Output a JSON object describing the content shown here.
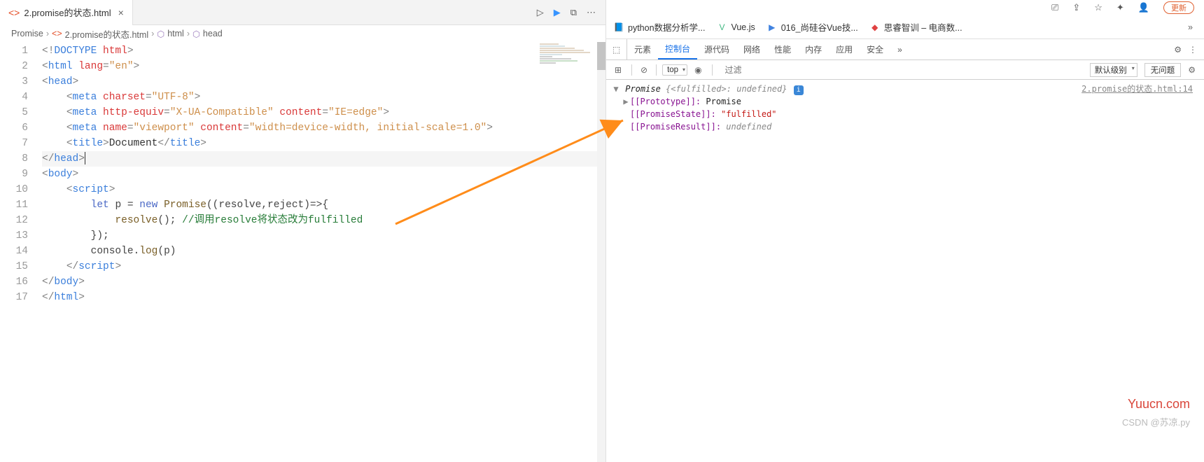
{
  "editor": {
    "tab": {
      "filename": "2.promise的状态.html"
    },
    "breadcrumb": [
      "Promise",
      "2.promise的状态.html",
      "html",
      "head"
    ],
    "lines": [
      {
        "n": 1,
        "html": "<span class='t-gray'>&lt;!</span><span class='t-blue'>DOCTYPE</span> <span class='t-red'>html</span><span class='t-gray'>&gt;</span>"
      },
      {
        "n": 2,
        "html": "<span class='t-gray'>&lt;</span><span class='t-blue'>html</span> <span class='t-red'>lang</span><span class='t-gray'>=</span><span class='t-str'>\"en\"</span><span class='t-gray'>&gt;</span>"
      },
      {
        "n": 3,
        "html": "<span class='t-gray'>&lt;</span><span class='t-blue'>head</span><span class='t-gray'>&gt;</span>"
      },
      {
        "n": 4,
        "html": "    <span class='t-gray'>&lt;</span><span class='t-blue'>meta</span> <span class='t-red'>charset</span><span class='t-gray'>=</span><span class='t-str'>\"UTF-8\"</span><span class='t-gray'>&gt;</span>"
      },
      {
        "n": 5,
        "html": "    <span class='t-gray'>&lt;</span><span class='t-blue'>meta</span> <span class='t-red'>http-equiv</span><span class='t-gray'>=</span><span class='t-str'>\"X-UA-Compatible\"</span> <span class='t-red'>content</span><span class='t-gray'>=</span><span class='t-str'>\"IE=edge\"</span><span class='t-gray'>&gt;</span>"
      },
      {
        "n": 6,
        "html": "    <span class='t-gray'>&lt;</span><span class='t-blue'>meta</span> <span class='t-red'>name</span><span class='t-gray'>=</span><span class='t-str'>\"viewport\"</span> <span class='t-red'>content</span><span class='t-gray'>=</span><span class='t-str'>\"width=device-width, initial-scale=1.0\"</span><span class='t-gray'>&gt;</span>"
      },
      {
        "n": 7,
        "html": "    <span class='t-gray'>&lt;</span><span class='t-blue'>title</span><span class='t-gray'>&gt;</span><span class='t-text'>Document</span><span class='t-gray'>&lt;/</span><span class='t-blue'>title</span><span class='t-gray'>&gt;</span>"
      },
      {
        "n": 8,
        "hl": true,
        "html": "<span class='t-gray'>&lt;/</span><span class='t-blue'>head</span><span class='t-gray'>&gt;</span><span class='cursor'></span>"
      },
      {
        "n": 9,
        "html": "<span class='t-gray'>&lt;</span><span class='t-blue'>body</span><span class='t-gray'>&gt;</span>"
      },
      {
        "n": 10,
        "html": "    <span class='t-gray'>&lt;</span><span class='t-blue'>script</span><span class='t-gray'>&gt;</span>"
      },
      {
        "n": 11,
        "html": "        <span class='t-kw'>let</span> <span class='t-dark'>p</span> <span class='t-dark'>=</span> <span class='t-kw'>new</span> <span class='t-name'>Promise</span><span class='t-dark'>((</span><span class='t-dark'>resolve</span><span class='t-dark'>,</span><span class='t-dark'>reject</span><span class='t-dark'>)=&gt;{</span>"
      },
      {
        "n": 12,
        "html": "            <span class='t-name'>resolve</span><span class='t-dark'>();</span> <span class='t-green'>//调用resolve将状态改为fulfilled</span>"
      },
      {
        "n": 13,
        "html": "        <span class='t-dark'>});</span>"
      },
      {
        "n": 14,
        "html": "        <span class='t-dark'>console</span><span class='t-dark'>.</span><span class='t-name'>log</span><span class='t-dark'>(</span><span class='t-dark'>p</span><span class='t-dark'>)</span>"
      },
      {
        "n": 15,
        "html": "    <span class='t-gray'>&lt;/</span><span class='t-blue'>script</span><span class='t-gray'>&gt;</span>"
      },
      {
        "n": 16,
        "html": "<span class='t-gray'>&lt;/</span><span class='t-blue'>body</span><span class='t-gray'>&gt;</span>"
      },
      {
        "n": 17,
        "html": "<span class='t-gray'>&lt;/</span><span class='t-blue'>html</span><span class='t-gray'>&gt;</span>"
      }
    ]
  },
  "browser": {
    "updateLabel": "更新",
    "bookmarks": [
      {
        "icon": "📘",
        "cls": "bm-blue",
        "label": "python数据分析学..."
      },
      {
        "icon": "V",
        "cls": "bm-green",
        "label": "Vue.js"
      },
      {
        "icon": "▶",
        "cls": "bm-blue",
        "label": "016_尚硅谷Vue技..."
      },
      {
        "icon": "◆",
        "cls": "bm-red",
        "label": "思睿智训 – 电商数..."
      }
    ]
  },
  "devtools": {
    "tabs": [
      "元素",
      "控制台",
      "源代码",
      "网络",
      "性能",
      "内存",
      "应用",
      "安全"
    ],
    "activeTab": 1,
    "context": "top",
    "filterPlaceholder": "过滤",
    "levelLabel": "默认级别",
    "issueLabel": "无问题",
    "sourceLink": "2.promise的状态.html:14",
    "console": {
      "header": {
        "label": "Promise",
        "state": "<fulfilled>",
        "value": "undefined"
      },
      "rows": [
        {
          "key": "[[Prototype]]:",
          "val": "Promise",
          "valCls": "c-dark",
          "expand": true
        },
        {
          "key": "[[PromiseState]]:",
          "val": "\"fulfilled\"",
          "valCls": "c-red",
          "expand": false
        },
        {
          "key": "[[PromiseResult]]:",
          "val": "undefined",
          "valCls": "c-gray",
          "expand": false
        }
      ]
    }
  },
  "watermark1": "Yuucn.com",
  "watermark2": "CSDN @苏凉.py"
}
